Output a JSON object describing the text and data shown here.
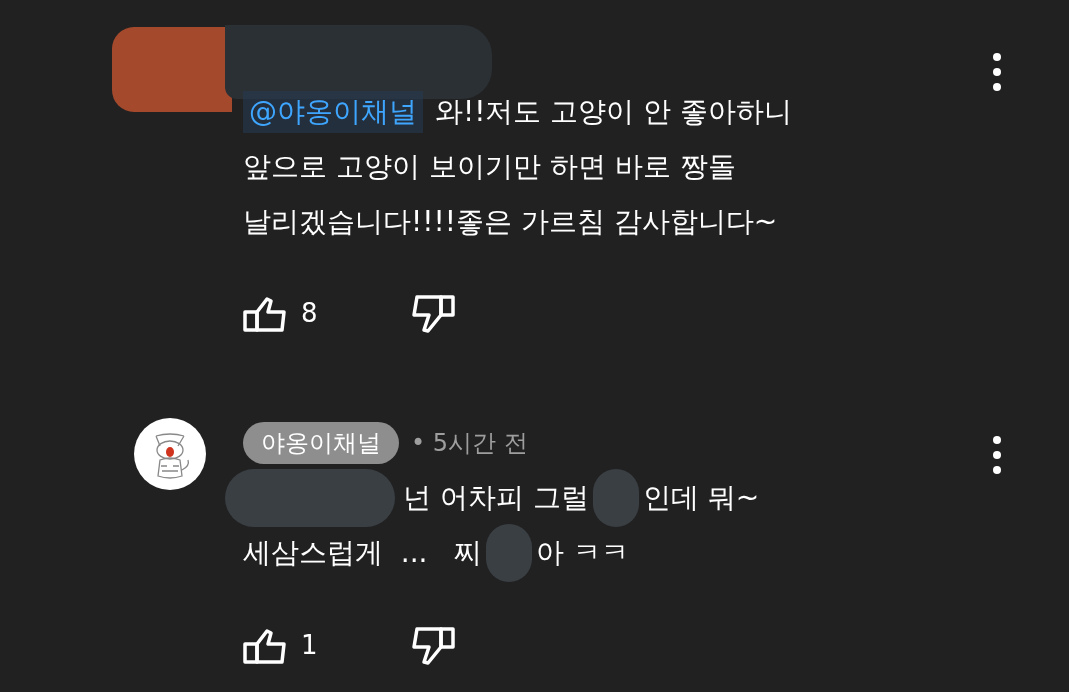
{
  "comments": [
    {
      "header_redacted": true,
      "avatar": {
        "kind": "redaction"
      },
      "lines": [
        [
          {
            "kind": "mention",
            "text": "@야옹이채널"
          },
          {
            "kind": "text",
            "text": "와!!저도 고양이 안 좋아하니"
          }
        ],
        [
          {
            "kind": "text",
            "text": "앞으로 고양이 보이기만 하면 바로 짱돌"
          }
        ],
        [
          {
            "kind": "text",
            "text": "날리겠습니다!!!!좋은 가르침 감사합니다~"
          }
        ]
      ],
      "likes": "8"
    },
    {
      "header_redacted": false,
      "avatar": {
        "kind": "cat"
      },
      "author": "야옹이채널",
      "author_is_creator": true,
      "time": "• 5시간 전",
      "lines": [
        [
          {
            "kind": "redaction"
          },
          {
            "kind": "text",
            "text": "넌 어차피 그럴"
          },
          {
            "kind": "redaction"
          },
          {
            "kind": "text",
            "text": "인데 뭐~"
          }
        ],
        [
          {
            "kind": "text",
            "text": "세삼스럽게  ...   찌"
          },
          {
            "kind": "redaction"
          },
          {
            "kind": "text",
            "text": "아 ㅋㅋ"
          }
        ]
      ],
      "likes": "1"
    }
  ]
}
